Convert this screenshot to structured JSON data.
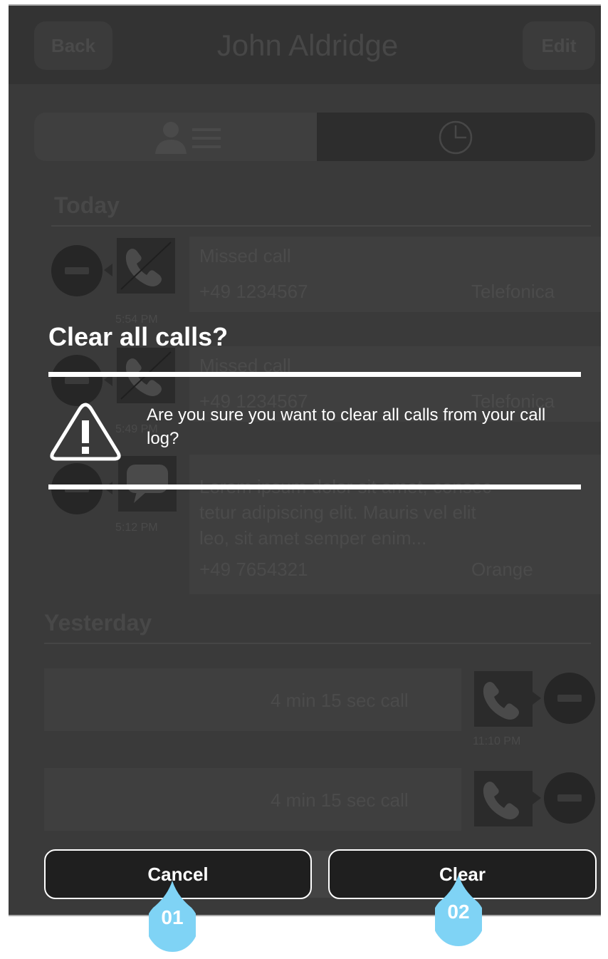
{
  "nav": {
    "back_label": "Back",
    "title": "John Aldridge",
    "edit_label": "Edit"
  },
  "sections": {
    "today": "Today",
    "yesterday": "Yesterday"
  },
  "today_calls": [
    {
      "type": "Missed call",
      "number": "+49 1234567",
      "carrier": "Telefonica",
      "time": "5:54 PM"
    },
    {
      "type": "Missed call",
      "number": "+49 1234567",
      "carrier": "Telefonica",
      "time": "5:49 PM"
    },
    {
      "message": [
        "Lorem ipsum dolor sit amet, consec-",
        "tetur adipiscing elit. Mauris vel elit",
        "leo, sit amet semper enim..."
      ],
      "number": "+49 7654321",
      "carrier": "Orange",
      "time": "5:12 PM"
    }
  ],
  "yesterday_calls": [
    {
      "summary": "4 min 15 sec call",
      "time": "11:10 PM"
    },
    {
      "summary": "4 min 15 sec call"
    }
  ],
  "dialog": {
    "title": "Clear all calls?",
    "message": "Are you sure you want to clear all calls from your call log?",
    "cancel_label": "Cancel",
    "clear_label": "Clear"
  },
  "callouts": [
    "01",
    "02"
  ],
  "colors": {
    "callout": "#7fd3f5",
    "dialog_text": "#ffffff",
    "button_bg": "#1f1f1f"
  }
}
